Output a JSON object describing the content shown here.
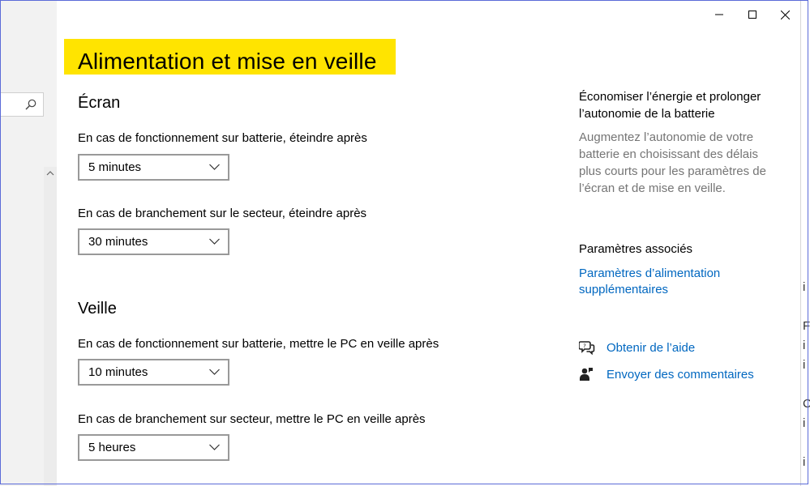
{
  "window": {
    "title": "Alimentation et mise en veille",
    "controls": [
      "minimize",
      "maximize",
      "close"
    ]
  },
  "screen_section": {
    "heading": "Écran",
    "battery_label": "En cas de fonctionnement sur batterie, éteindre après",
    "battery_value": "5 minutes",
    "plugged_label": "En cas de branchement sur le secteur, éteindre après",
    "plugged_value": "30 minutes"
  },
  "sleep_section": {
    "heading": "Veille",
    "battery_label": "En cas de fonctionnement sur batterie, mettre le PC en veille après",
    "battery_value": "10 minutes",
    "plugged_label": "En cas de branchement sur secteur, mettre le PC en veille après",
    "plugged_value": "5 heures"
  },
  "aside": {
    "tip_title": "Économiser l’énergie et prolonger l’autonomie de la batterie",
    "tip_desc": "Augmentez l’autonomie de votre batterie en choisissant des délais plus courts pour les paramètres de l’écran et de mise en veille.",
    "related_title": "Paramètres associés",
    "related_link": "Paramètres d’alimentation supplémentaires",
    "help_link": "Obtenir de l’aide",
    "feedback_link": "Envoyer des commentaires"
  },
  "colors": {
    "highlight": "#ffe400",
    "link": "#0067c0",
    "muted_text": "#757575"
  },
  "icons": [
    "search-icon",
    "scroll-up-icon",
    "minimize-icon",
    "maximize-icon",
    "close-icon",
    "chevron-down-icon",
    "help-chat-icon",
    "feedback-icon"
  ]
}
